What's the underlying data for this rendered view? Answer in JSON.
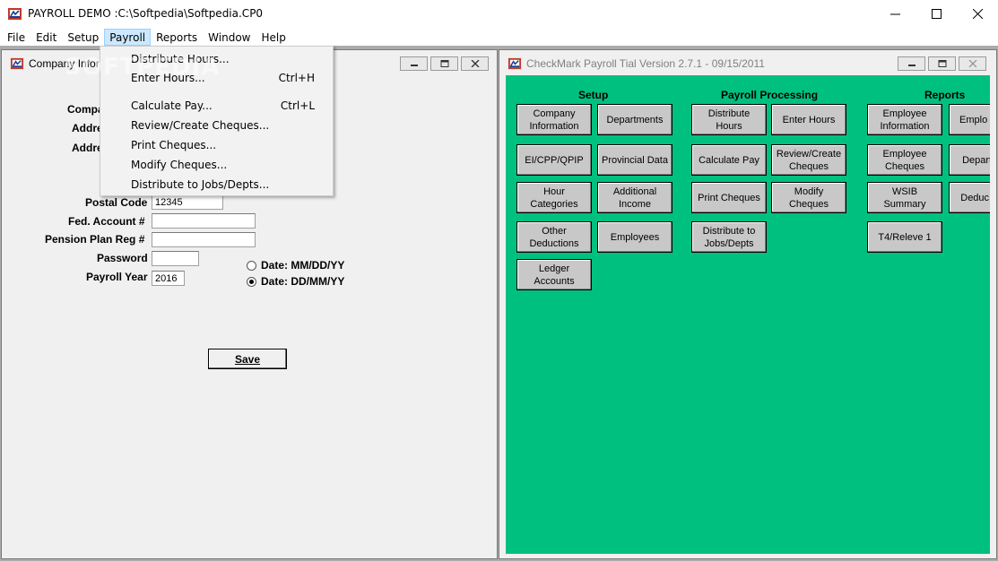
{
  "app": {
    "title": "PAYROLL DEMO :C:\\Softpedia\\Softpedia.CP0",
    "controls": {
      "minimize": "—",
      "maximize": "☐",
      "close": "✕"
    }
  },
  "menubar": [
    {
      "id": "file",
      "label": "File"
    },
    {
      "id": "edit",
      "label": "Edit"
    },
    {
      "id": "setup",
      "label": "Setup"
    },
    {
      "id": "payroll",
      "label": "Payroll",
      "active": true
    },
    {
      "id": "reports",
      "label": "Reports"
    },
    {
      "id": "window",
      "label": "Window"
    },
    {
      "id": "help",
      "label": "Help"
    }
  ],
  "payroll_menu": [
    {
      "label": "Distribute Hours...",
      "shortcut": ""
    },
    {
      "label": "Enter Hours...",
      "shortcut": "Ctrl+H"
    },
    {
      "label": "Calculate Pay...",
      "shortcut": "Ctrl+L"
    },
    {
      "label": "Review/Create Cheques...",
      "shortcut": ""
    },
    {
      "label": "Print Cheques...",
      "shortcut": ""
    },
    {
      "label": "Modify Cheques...",
      "shortcut": ""
    },
    {
      "label": "Distribute to Jobs/Depts...",
      "shortcut": ""
    }
  ],
  "watermark": "SOFTPEDIA",
  "company_window": {
    "title": "Company Infor",
    "labels": {
      "company": "Compa",
      "address1": "Addre",
      "address2": "Addre",
      "postal_code": "Postal Code",
      "fed_account": "Fed. Account #",
      "pension_plan": "Pension Plan Reg #",
      "password": "Password",
      "payroll_year": "Payroll Year"
    },
    "values": {
      "postal_code": "12345",
      "fed_account": "",
      "pension_plan": "",
      "password": "",
      "payroll_year": "2016"
    },
    "date_format_options": [
      {
        "label": "Date: MM/DD/YY",
        "selected": false
      },
      {
        "label": "Date: DD/MM/YY",
        "selected": true
      }
    ],
    "save_label": "Save"
  },
  "checkmark_window": {
    "title": "CheckMark Payroll Tial Version 2.7.1 - 09/15/2011",
    "panel_color": "#00c080",
    "sections": {
      "setup": "Setup",
      "payroll_processing": "Payroll Processing",
      "reports": "Reports"
    },
    "buttons": {
      "company_information": "Company Information",
      "departments": "Departments",
      "ei_cpp_qpip": "EI/CPP/QPIP",
      "provincial_data": "Provincial Data",
      "hour_categories": "Hour Categories",
      "additional_income": "Additional Income",
      "other_deductions": "Other Deductions",
      "employees": "Employees",
      "ledger_accounts": "Ledger Accounts",
      "distribute_hours": "Distribute Hours",
      "enter_hours": "Enter Hours",
      "calculate_pay": "Calculate Pay",
      "review_create_cheques": "Review/Create Cheques",
      "print_cheques": "Print Cheques",
      "modify_cheques": "Modify Cheques",
      "distribute_jobs_depts": "Distribute to Jobs/Depts",
      "employee_information": "Employee Information",
      "employee_earnings": "Emplo Earni",
      "employee_cheques": "Employee Cheques",
      "department_jobs": "Depart Job",
      "wsib_summary": "WSIB Summary",
      "deduction_register": "Deduc Regi",
      "t4_releve": "T4/Releve 1"
    }
  }
}
